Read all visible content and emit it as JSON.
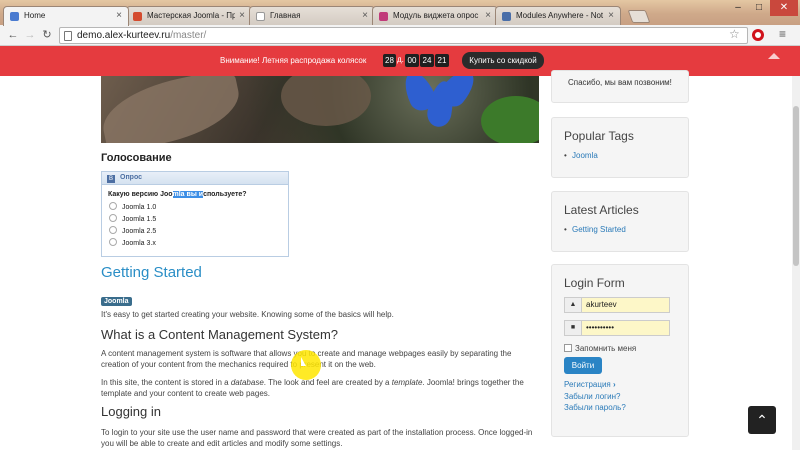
{
  "browser": {
    "tabs": [
      {
        "label": "Home",
        "icon_color": "#4a7bd0",
        "active": true
      },
      {
        "label": "Мастерская Joomla - Пр",
        "icon_color": "#d44b2e",
        "active": false
      },
      {
        "label": "Главная",
        "icon_color": "#ffffff",
        "active": false
      },
      {
        "label": "Модуль виджета опрос",
        "icon_color": "#c13b7a",
        "active": false
      },
      {
        "label": "Modules Anywhere - Not",
        "icon_color": "#4a6ea8",
        "active": false
      }
    ],
    "url_host": "demo.alex-kurteev.ru",
    "url_path": "/master/",
    "window_controls": {
      "minimize": "–",
      "maximize": "□",
      "close": "✕"
    }
  },
  "banner": {
    "message": "Внимание! Летняя распродажа колясок",
    "countdown": {
      "days": "28",
      "days_label": "д.",
      "hours": "00",
      "minutes": "24",
      "seconds": "21"
    },
    "buy_label": "Купить со скидкой",
    "color": "#e53b3f"
  },
  "main": {
    "vote_heading": "Голосование",
    "poll": {
      "header": "Опрос",
      "question_before": "Какую версию Joo",
      "question_selected": "mla вы и",
      "question_after": "спользуете?",
      "options": [
        "Joomla 1.0",
        "Joomla 1.5",
        "Joomla 2.5",
        "Joomla 3.x"
      ]
    },
    "article_title": "Getting Started",
    "category_badge": "Joomla",
    "intro": "It's easy to get started creating your website. Knowing some of the basics will help.",
    "h_cms": "What is a Content Management System?",
    "p_cms": "A content management system is software that allows you to create and manage webpages easily by separating the creation of your content from the mechanics required to present it on the web.",
    "p_site_1": "In this site, the content is stored in a ",
    "p_site_em1": "database",
    "p_site_2": ". The look and feel are created by a ",
    "p_site_em2": "template",
    "p_site_3": ". Joomla! brings together the template and your content to create web pages.",
    "h_login": "Logging in",
    "p_login": "To login to your site use the user name and password that were created as part of the installation process. Once logged-in you will be able to create and edit articles and modify some settings."
  },
  "sidebar": {
    "callback_text": "Спасибо, мы вам позвоним!",
    "popular_tags": {
      "title": "Popular Tags",
      "items": [
        "Joomla"
      ]
    },
    "latest_articles": {
      "title": "Latest Articles",
      "items": [
        "Getting Started"
      ]
    },
    "login_form": {
      "title": "Login Form",
      "username": "akurteev",
      "password": "••••••••••",
      "remember_label": "Запомнить меня",
      "submit_label": "Войти",
      "register_label": "Регистрация",
      "forgot_login_label": "Забыли логин?",
      "forgot_password_label": "Забыли пароль?"
    }
  }
}
